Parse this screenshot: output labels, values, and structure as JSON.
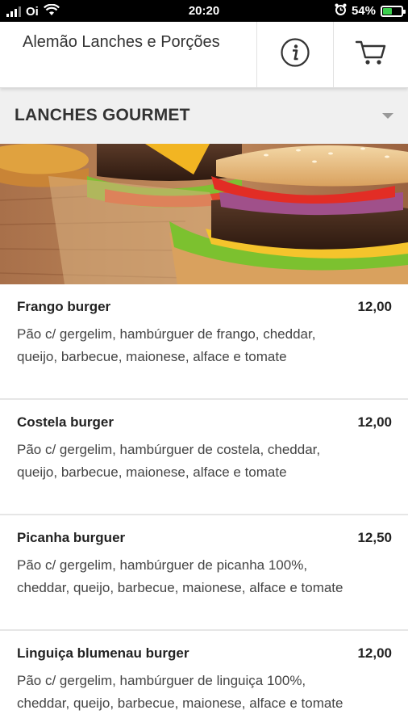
{
  "status_bar": {
    "carrier": "Oi",
    "time": "20:20",
    "battery_percent": "54%",
    "battery_level": 0.54,
    "icons": [
      "signal-icon",
      "wifi-icon",
      "alarm-icon",
      "battery-charging-icon"
    ]
  },
  "header": {
    "title": "Alemão Lanches e Porções",
    "info_icon": "info-icon",
    "cart_icon": "cart-icon"
  },
  "category": {
    "selected": "LANCHES GOURMET",
    "icon": "dropdown-caret-icon"
  },
  "banner": {
    "image": "burger-banner-photo"
  },
  "items": [
    {
      "name": "Frango burger",
      "price": "12,00",
      "description": "Pão c/ gergelim, hambúrguer de frango, cheddar, queijo, barbecue, maionese, alface e tomate"
    },
    {
      "name": "Costela burger",
      "price": "12,00",
      "description": "Pão c/ gergelim, hambúrguer de costela, cheddar, queijo, barbecue, maionese, alface e tomate"
    },
    {
      "name": "Picanha burguer",
      "price": "12,50",
      "description": "Pão c/ gergelim, hambúrguer de picanha 100%, cheddar, queijo, barbecue, maionese, alface e tomate"
    },
    {
      "name": "Linguiça blumenau burger",
      "price": "12,00",
      "description": "Pão c/ gergelim, hambúrguer de linguiça 100%, cheddar, queijo, barbecue, maionese, alface e tomate"
    }
  ],
  "colors": {
    "status_bar_bg": "#000000",
    "category_bg": "#f0f0f0",
    "battery_fill": "#3ccf4e",
    "text_primary": "#222222"
  }
}
